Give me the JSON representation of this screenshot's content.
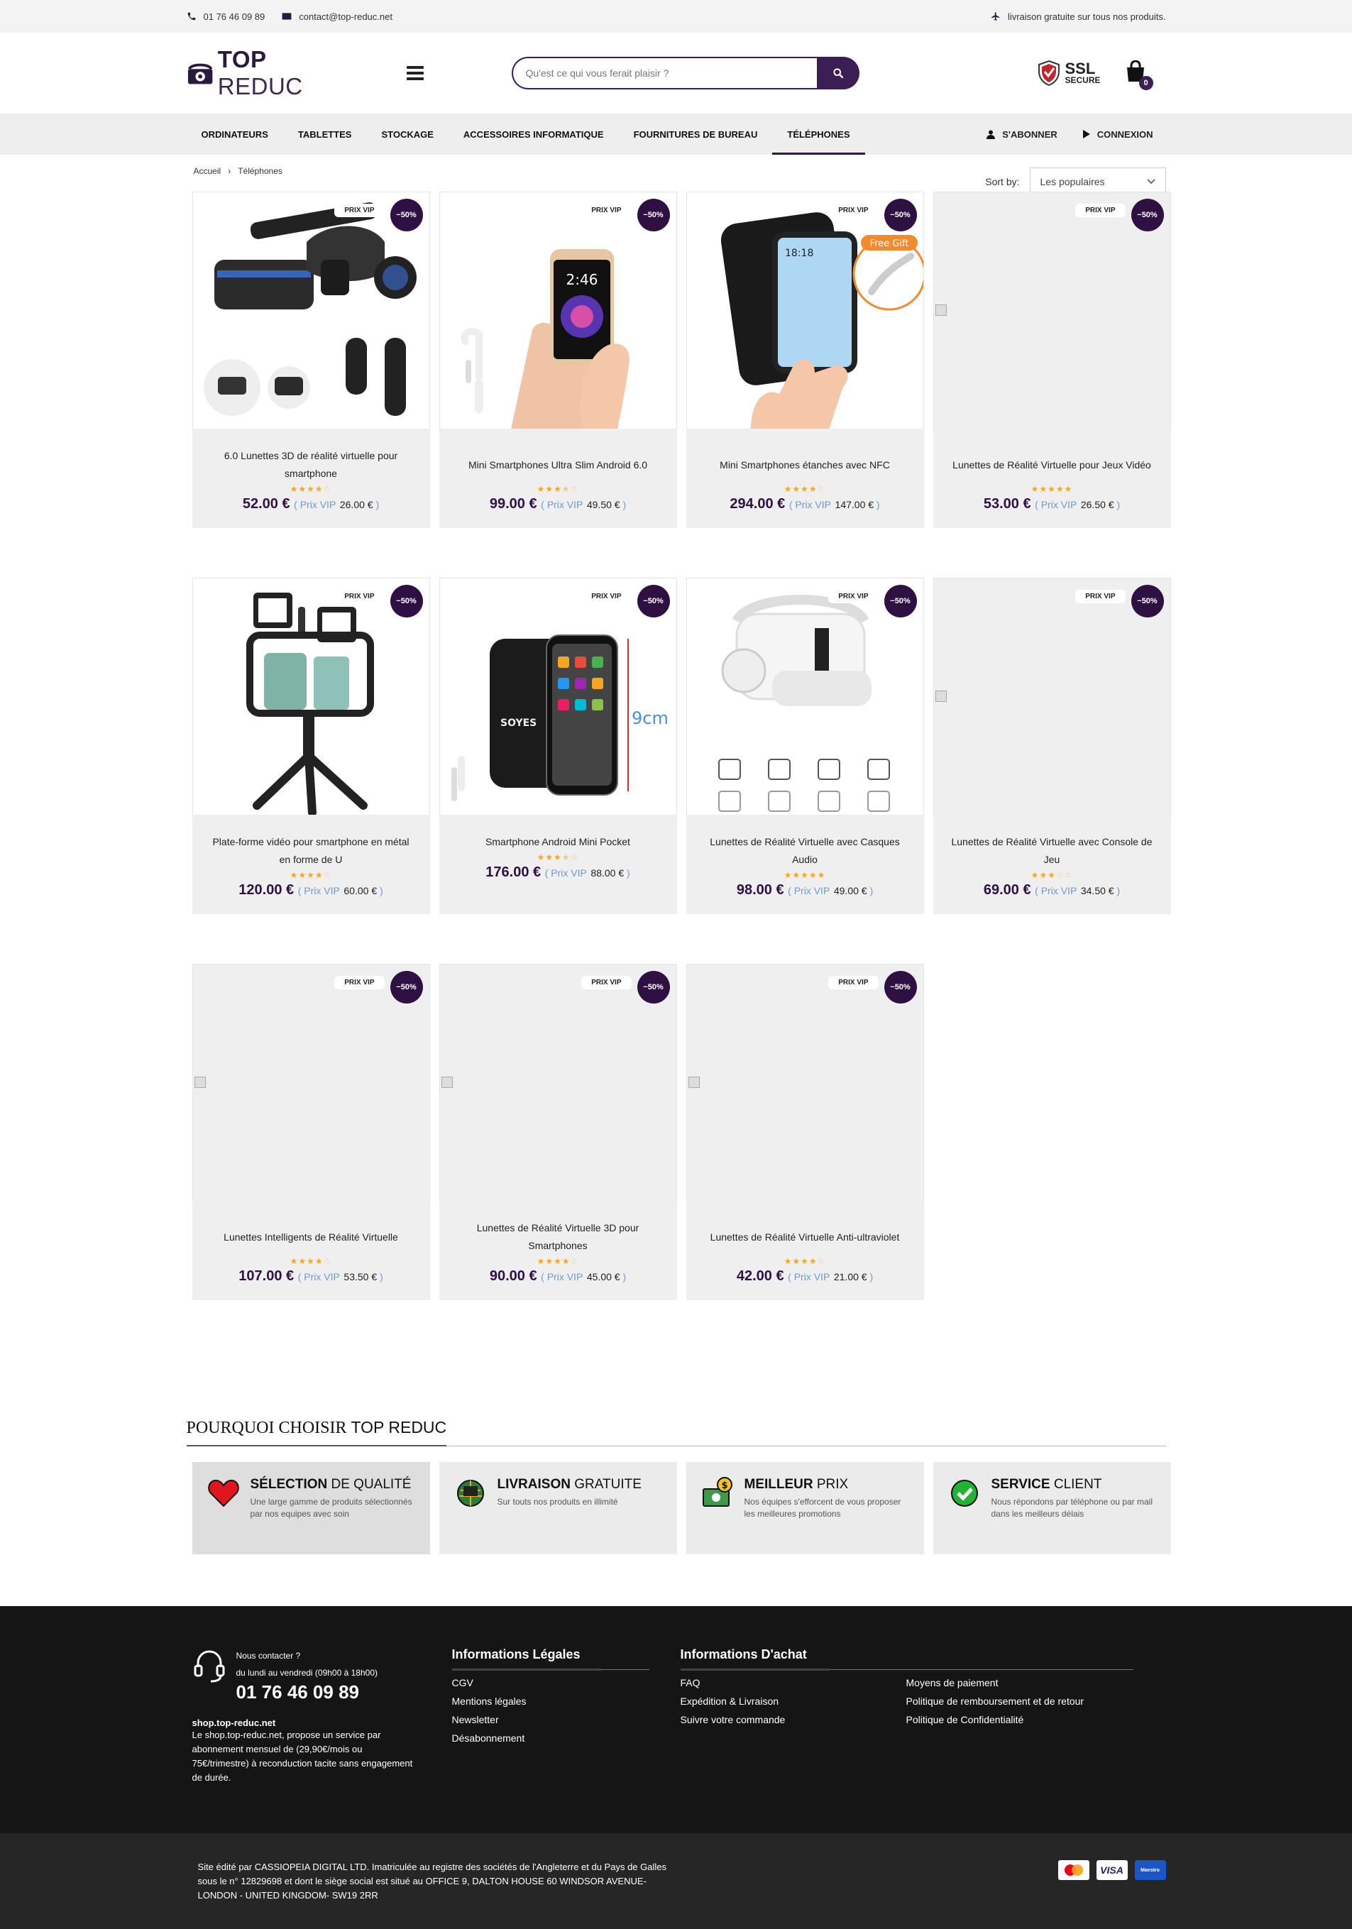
{
  "topbar": {
    "phone": "01 76 46 09 89",
    "email": "contact@top-reduc.net",
    "shipping": "livraison gratuite sur tous nos produits."
  },
  "header": {
    "logo_bold": "TOP",
    "logo_light": "REDUC",
    "search_placeholder": "Qu'est ce qui vous ferait plaisir ?",
    "ssl_line1": "SSL",
    "ssl_line2": "SECURE",
    "cart_count": "0"
  },
  "nav": {
    "items": [
      {
        "label": "ORDINATEURS"
      },
      {
        "label": "TABLETTES"
      },
      {
        "label": "STOCKAGE"
      },
      {
        "label": "ACCESSOIRES INFORMATIQUE"
      },
      {
        "label": "FOURNITURES DE BUREAU"
      },
      {
        "label": "TÉLÉPHONES"
      }
    ],
    "active": "TÉLÉPHONES",
    "subscribe": "S'ABONNER",
    "login": "CONNEXION"
  },
  "breadcrumb": {
    "home": "Accueil",
    "separator": "›",
    "current": "Téléphones"
  },
  "sort": {
    "label": "Sort by:",
    "selected": "Les populaires"
  },
  "badges": {
    "vip": "PRIX VIP",
    "discount": "−50%",
    "vip_label": "Prix VIP"
  },
  "products": [
    {
      "name": "6.0 Lunettes 3D de réalité virtuelle pour smartphone",
      "rating": 4,
      "price": "52.00 €",
      "vip_price": "26.00 €",
      "image": "vr-headset"
    },
    {
      "name": "Mini Smartphones Ultra Slim Android 6.0",
      "rating": 3.5,
      "price": "99.00 €",
      "vip_price": "49.50 €",
      "image": "mini-phone-hand"
    },
    {
      "name": "Mini Smartphones étanches avec NFC",
      "rating": 4,
      "price": "294.00 €",
      "vip_price": "147.00 €",
      "image": "rugged-phone-hand",
      "image_text": "Free Gift"
    },
    {
      "name": "Lunettes de Réalité Virtuelle pour Jeux Vidéo",
      "rating": 5,
      "price": "53.00 €",
      "vip_price": "26.50 €",
      "image": "broken"
    },
    {
      "name": "Plate-forme vidéo pour smartphone en métal en forme de U",
      "rating": 4,
      "price": "120.00 €",
      "vip_price": "60.00 €",
      "image": "vlog-rig"
    },
    {
      "name": "Smartphone Android Mini Pocket",
      "rating": 3.5,
      "price": "176.00 €",
      "vip_price": "88.00 €",
      "image": "pocket-phone",
      "image_text": "9cm"
    },
    {
      "name": "Lunettes de Réalité Virtuelle avec Casques Audio",
      "rating": 5,
      "price": "98.00 €",
      "vip_price": "49.00 €",
      "image": "white-vr"
    },
    {
      "name": "Lunettes de Réalité Virtuelle avec Console de Jeu",
      "rating": 3,
      "price": "69.00 €",
      "vip_price": "34.50 €",
      "image": "broken"
    },
    {
      "name": "Lunettes Intelligents de Réalité Virtuelle",
      "rating": 4,
      "price": "107.00 €",
      "vip_price": "53.50 €",
      "image": "broken"
    },
    {
      "name": "Lunettes de Réalité Virtuelle 3D pour Smartphones",
      "rating": 4,
      "price": "90.00 €",
      "vip_price": "45.00 €",
      "image": "broken"
    },
    {
      "name": "Lunettes de Réalité Virtuelle Anti-ultraviolet",
      "rating": 4,
      "price": "42.00 €",
      "vip_price": "21.00 €",
      "image": "broken"
    }
  ],
  "why": {
    "title_serif": "POURQUOI CHOISIR",
    "title_brand": "TOP REDUC",
    "boxes": [
      {
        "bold": "SÉLECTION",
        "light": " DE QUALITÉ",
        "text": "Une large gamme de produits sélectionnés par nos equipes avec soin",
        "icon": "heart-icon"
      },
      {
        "bold": "LIVRAISON",
        "light": " GRATUITE",
        "text": "Sur touts nos produits en illimité",
        "icon": "globe-cart-icon"
      },
      {
        "bold": "MEILLEUR",
        "light": " PRIX",
        "text": "Nos équipes s'efforcent de vous proposer les meilleures promotions",
        "icon": "money-icon"
      },
      {
        "bold": "SERVICE",
        "light": " CLIENT",
        "text": "Nous répondons par téléphone ou par mail dans les meilleurs délais",
        "icon": "check-icon"
      }
    ]
  },
  "footer": {
    "contact_q": "Nous contacter ?",
    "hours": "du lundi au vendredi (09h00 à 18h00)",
    "phone": "01 76 46 09 89",
    "site": "shop.top-reduc.net",
    "desc": "Le shop.top-reduc.net, propose un service par abonnement mensuel de (29,90€/mois ou 75€/trimestre) à reconduction tacite sans engagement de durée.",
    "legal_title": "Informations Légales",
    "legal_links": [
      "CGV",
      "Mentions légales",
      "Newsletter",
      "Désabonnement"
    ],
    "buy_title": "Informations D'achat",
    "buy_links": [
      "FAQ",
      "Moyens de paiement",
      "Expédition & Livraison",
      "Politique de remboursement et de retour",
      "Suivre votre commande",
      "Politique de Confidentialité"
    ],
    "bottom_text": "Site édité par CASSIOPEIA DIGITAL LTD. Imatriculée au registre des sociétés de l'Angleterre et du Pays de Galles sous le n° 12829698 et dont le siège social est situé au OFFICE 9, DALTON HOUSE 60 WINDSOR AVENUE- LONDON - UNITED KINGDOM- SW19 2RR",
    "payments": [
      "MasterCard",
      "VISA",
      "Maestro"
    ]
  },
  "colors": {
    "brand": "#2e1042",
    "star": "#f5a623",
    "footer": "#151515"
  }
}
